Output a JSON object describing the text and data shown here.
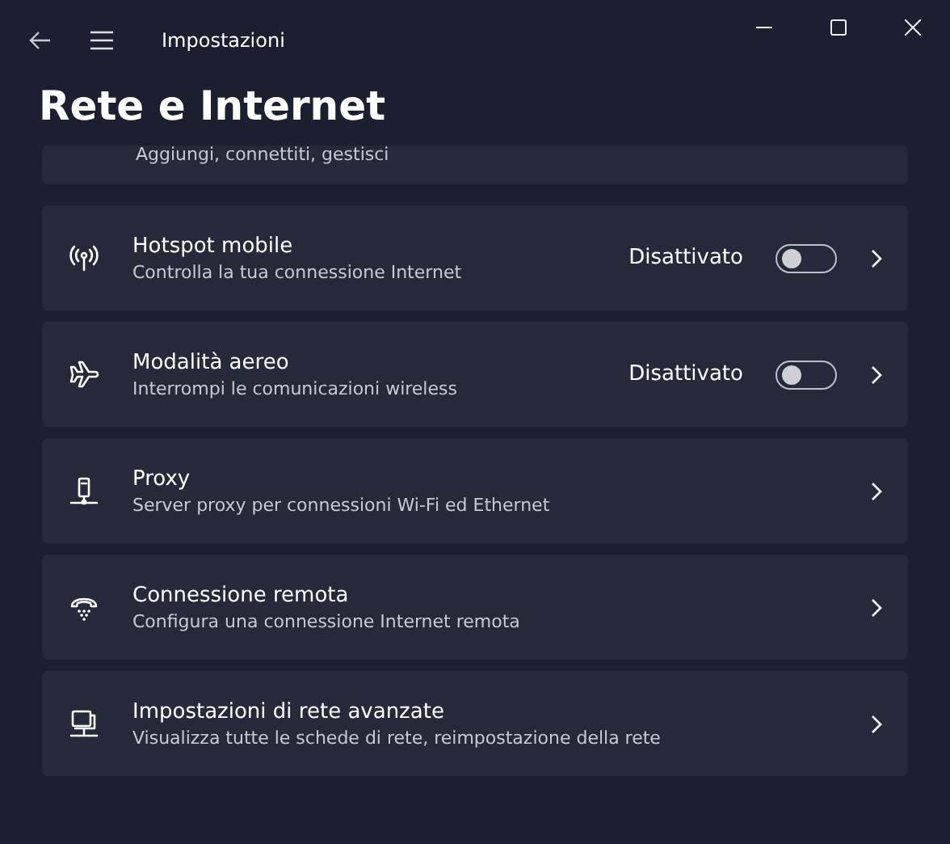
{
  "window": {
    "title": "Impostazioni"
  },
  "page_title": "Rete e Internet",
  "partial_item": {
    "subtitle": "Aggiungi, connettiti, gestisci"
  },
  "items": [
    {
      "kind": "hotspot",
      "title": "Hotspot mobile",
      "subtitle": "Controlla la tua connessione Internet",
      "status": "Disattivato",
      "on": false
    },
    {
      "kind": "airplane",
      "title": "Modalità aereo",
      "subtitle": "Interrompi le comunicazioni wireless",
      "status": "Disattivato",
      "on": false
    },
    {
      "kind": "proxy",
      "title": "Proxy",
      "subtitle": "Server proxy per connessioni Wi-Fi ed Ethernet"
    },
    {
      "kind": "dialup",
      "title": "Connessione remota",
      "subtitle": "Configura una connessione Internet remota"
    },
    {
      "kind": "advanced",
      "title": "Impostazioni di rete avanzate",
      "subtitle": "Visualizza tutte le schede di rete, reimpostazione della rete"
    }
  ]
}
